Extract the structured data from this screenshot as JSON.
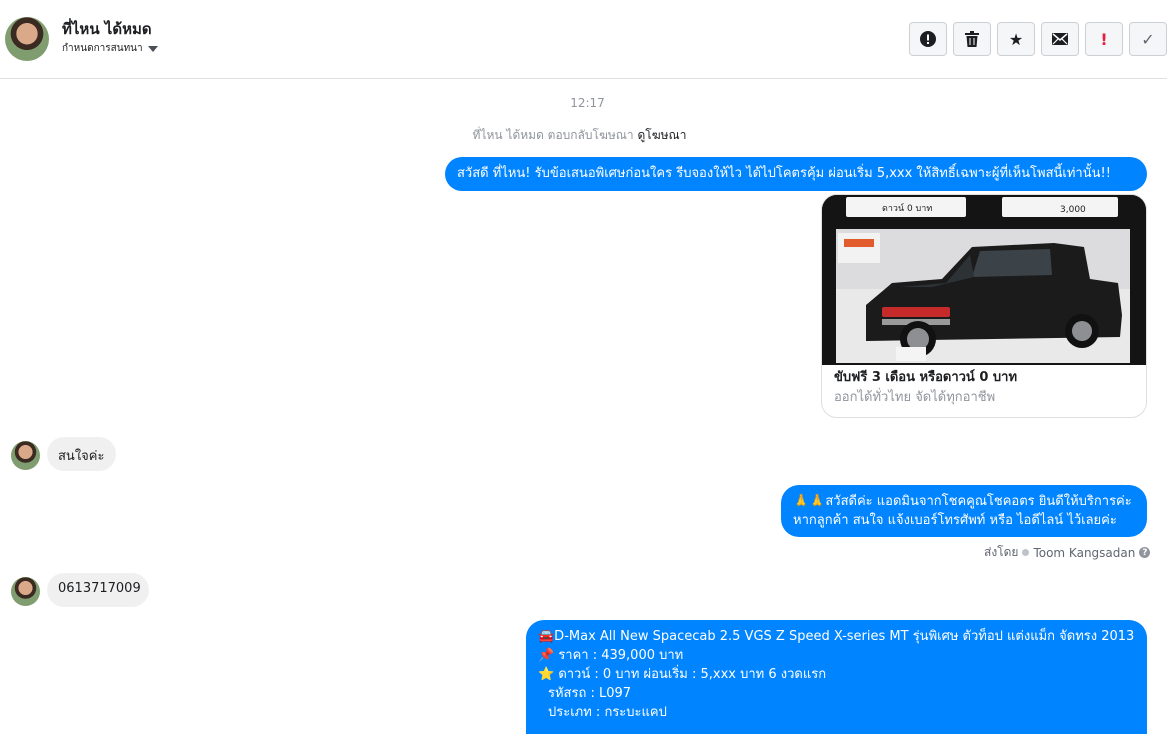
{
  "header": {
    "contact_name": "ที่ไหน ได้หมด",
    "assign_label": "กำหนดการสนทนา",
    "toolbar": {
      "spam_icon": "!",
      "delete_icon": "🗑",
      "star_icon": "★",
      "mail_icon": "✉",
      "important_icon": "!",
      "done_icon": "✓"
    }
  },
  "thread": {
    "timestamp": "12:17",
    "ad_reply_text": "ที่ไหน ได้หมด ตอบกลับโฆษณา",
    "ad_link": "ดูโฆษณา",
    "msg1": "สวัสดี ที่ไหน! รับข้อเสนอพิเศษก่อนใคร รีบจองให้ไว ได้ไปโคตรคุ้ม ผ่อนเริ่ม 5,xxx  ให้สิทธิ์เฉพาะผู้ที่เห็นโพสนี้เท่านั้น!!",
    "ad_card": {
      "title": "ขับฟรี 3 เดือน หรือดาวน์ 0 บาท",
      "subtitle": "ออกได้ทั่วไทย จัดได้ทุกอาชีพ",
      "banner_left": "ดาวน์ 0 บาท",
      "banner_right": "3,000"
    },
    "msg2": "สนใจค่ะ",
    "msg3_line1": "🙏🙏สวัสดีค่ะ แอดมินจากโชคคูณโชคอตร ยินดีให้บริการค่ะ",
    "msg3_line2": "หากลูกค้า สนใจ แจ้งเบอร์โทรศัพท์ หรือ ไอดีไลน์  ไว้เลยค่ะ",
    "sent_by_label": "ส่งโดย",
    "sent_by_name": "Toom Kangsadan",
    "msg4": "0613717009",
    "msg5_line1": "🚘D-Max All New Spacecab 2.5 VGS Z Speed X-series MT รุ่นพิเศษ ตัวท็อป แต่งแม็ก จัดทรง 2013",
    "msg5_line2": "📌 ราคา : 439,000 บาท",
    "msg5_line3": "⭐ ดาวน์ : 0 บาท ผ่อนเริ่ม : 5,xxx บาท 6 งวดแรก",
    "msg5_line4": "รหัสรถ : L097",
    "msg5_line5": "ประเภท : กระบะแคป"
  },
  "colors": {
    "outgoing_bubble": "#0084ff",
    "incoming_bubble": "#f1f0f0",
    "meta_text": "#90949c"
  }
}
